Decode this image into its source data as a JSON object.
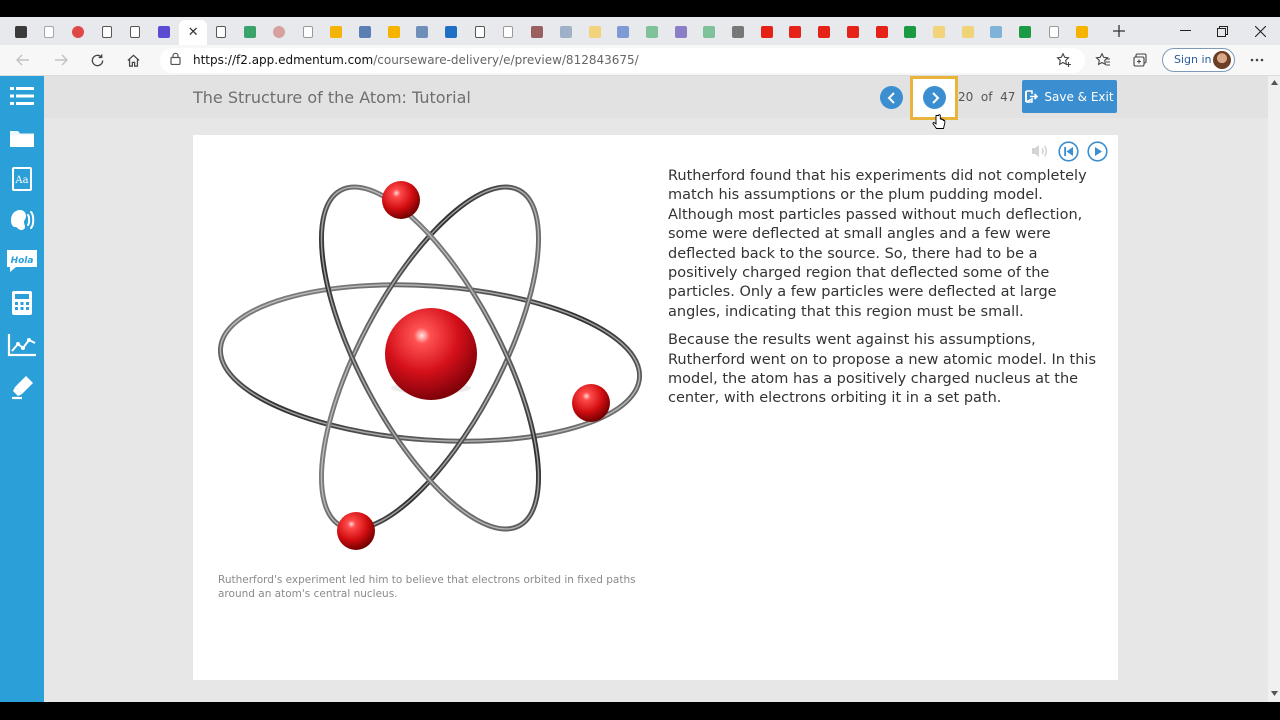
{
  "browser": {
    "url_domain": "https://f2.app.edmentum.com",
    "url_path": "/courseware-delivery/e/preview/812843675/",
    "signin_label": "Sign in",
    "tabs": [
      {
        "icon": "window-icon",
        "color": "#3a3a3a"
      },
      {
        "icon": "page-icon",
        "color": "#9aa7b4"
      },
      {
        "icon": "red-circle-icon",
        "color": "#e04848"
      },
      {
        "icon": "doc-icon",
        "color": "#555"
      },
      {
        "icon": "doc-icon",
        "color": "#555"
      },
      {
        "icon": "c-icon",
        "color": "#5b4bd3"
      },
      {
        "icon": "doc-icon",
        "color": "#555"
      },
      {
        "icon": "edge-icon",
        "color": "#3aa36b"
      },
      {
        "icon": "new-icon",
        "color": "#d6a0a0"
      },
      {
        "icon": "doc-icon",
        "color": "#9a9a9a"
      },
      {
        "icon": "slides-icon",
        "color": "#f4b400"
      },
      {
        "icon": "photos-icon",
        "color": "#5a7fb5"
      },
      {
        "icon": "slides-icon",
        "color": "#f4b400"
      },
      {
        "icon": "person-icon",
        "color": "#6d8fb8"
      },
      {
        "icon": "outlook-icon",
        "color": "#1f6fc5"
      },
      {
        "icon": "doc-icon",
        "color": "#555"
      },
      {
        "icon": "page-icon",
        "color": "#9a9a9a"
      },
      {
        "icon": "book-icon",
        "color": "#9a6060"
      },
      {
        "icon": "drive-icon",
        "color": "#9fb1c7"
      },
      {
        "icon": "slides-icon",
        "color": "#f1d37a"
      },
      {
        "icon": "docs-icon",
        "color": "#7e9ad6"
      },
      {
        "icon": "plus-icon",
        "color": "#7ec29a"
      },
      {
        "icon": "forms-icon",
        "color": "#8a7fc6"
      },
      {
        "icon": "plus-icon",
        "color": "#7ec29a"
      },
      {
        "icon": "clipboard-icon",
        "color": "#777"
      },
      {
        "icon": "youtube-icon",
        "color": "#e62117"
      },
      {
        "icon": "youtube-icon",
        "color": "#e62117"
      },
      {
        "icon": "youtube-icon",
        "color": "#e62117"
      },
      {
        "icon": "youtube-icon",
        "color": "#e62117"
      },
      {
        "icon": "youtube-icon",
        "color": "#e62117"
      },
      {
        "icon": "plus-icon",
        "color": "#1a9b43"
      },
      {
        "icon": "slides-icon",
        "color": "#f1d37a"
      },
      {
        "icon": "slides-icon",
        "color": "#f1d37a"
      },
      {
        "icon": "bing-icon",
        "color": "#7fb3d9"
      },
      {
        "icon": "plus-icon",
        "color": "#1a9b43"
      },
      {
        "icon": "page-icon",
        "color": "#9a9a9a"
      },
      {
        "icon": "drive-icon",
        "color": "#f4b400"
      }
    ]
  },
  "app": {
    "title": "The Structure of the Atom: Tutorial",
    "page_current": "20",
    "page_of": "of",
    "page_total": "47",
    "save_exit_label": "Save & Exit",
    "accent": "#2a9fd8",
    "button_color": "#3b8fd0",
    "highlight_color": "#e8b43c",
    "sidebar_items": [
      "list-icon",
      "folder-icon",
      "dictionary-icon",
      "audio-icon",
      "translate-icon",
      "calculator-icon",
      "graph-icon",
      "highlighter-icon"
    ],
    "sidebar_hola": "Hola",
    "sidebar_dict": "Aa"
  },
  "content": {
    "caption": "Rutherford's experiment led him to believe that electrons orbited in fixed paths around an atom's central nucleus.",
    "paragraphs": [
      "Rutherford found that his experiments did not completely match his assumptions or the plum pudding model. Although most particles passed without much deflection, some were deflected at small angles and a few were deflected back to the source. So, there had to be a positively charged region that deflected some of the particles. Only a few particles were deflected at large angles, indicating that this region must be small.",
      "Because the results went against his assumptions, Rutherford went on to propose a new atomic model. In this model, the atom has a positively charged nucleus at the center, with electrons orbiting it in a set path."
    ]
  }
}
